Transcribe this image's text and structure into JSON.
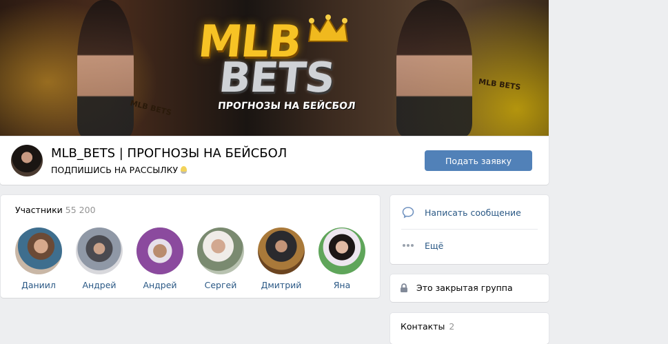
{
  "cover": {
    "logo_line1": "MLB",
    "logo_line2": "BETS",
    "logo_subtitle": "ПРОГНОЗЫ НА БЕЙСБОЛ",
    "bat_text_left": "MLB BETS",
    "bat_text_right": "MLB BETS"
  },
  "header": {
    "title": "MLB_BETS | ПРОГНОЗЫ НА БЕЙСБОЛ",
    "status": "ПОДПИШИСЬ НА РАССЫЛКУ",
    "status_icon": "lightbulb-icon",
    "apply_button": "Подать заявку"
  },
  "members": {
    "label": "Участники",
    "count": "55 200",
    "items": [
      {
        "name": "Даниил"
      },
      {
        "name": "Андрей"
      },
      {
        "name": "Андрей"
      },
      {
        "name": "Сергей"
      },
      {
        "name": "Дмитрий"
      },
      {
        "name": "Яна"
      }
    ]
  },
  "actions": {
    "message": "Написать сообщение",
    "more": "Ещё"
  },
  "privacy": {
    "label": "Это закрытая группа",
    "icon": "lock-icon"
  },
  "contacts": {
    "label": "Контакты",
    "count": "2"
  },
  "colors": {
    "accent": "#5181b8",
    "link": "#2a5885",
    "muted": "#939393",
    "page_bg": "#edeef0"
  }
}
